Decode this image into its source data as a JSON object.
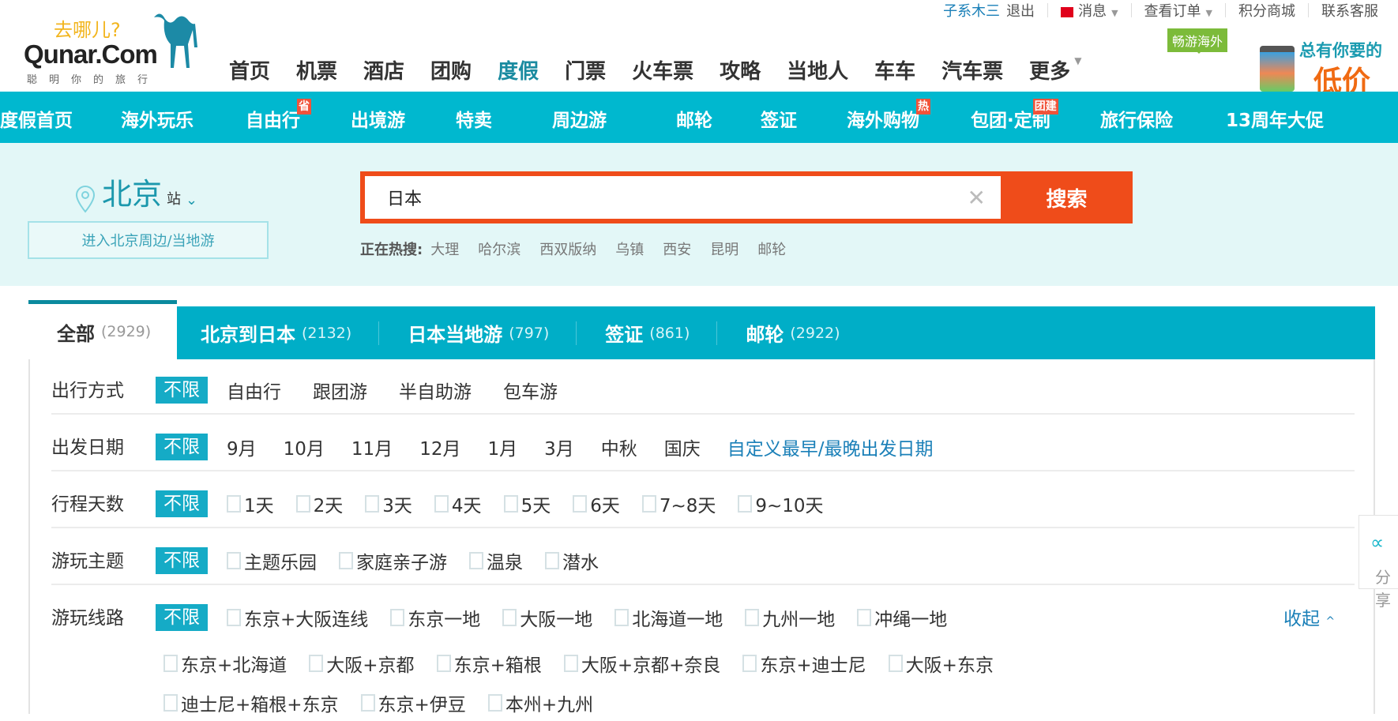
{
  "logo": {
    "slogan": "去哪儿?",
    "brand": "Qunar.Com",
    "sub": "聪明你的旅行"
  },
  "toplinks": {
    "user": "子系木三",
    "logout": "退出",
    "messages": "消息",
    "orders": "查看订单",
    "points": "积分商城",
    "service": "联系客服"
  },
  "mainnav": [
    "首页",
    "机票",
    "酒店",
    "团购",
    "度假",
    "门票",
    "火车票",
    "攻略",
    "当地人",
    "车车",
    "汽车票",
    "更多"
  ],
  "mainnav_active": "度假",
  "badge": "畅游海外",
  "ad": {
    "line1": "总有你要的",
    "line2": "低价"
  },
  "subnav": [
    {
      "label": "度假首页"
    },
    {
      "label": "海外玩乐"
    },
    {
      "label": "自由行",
      "tag": "省"
    },
    {
      "label": "出境游"
    },
    {
      "label": "特卖"
    },
    {
      "label": "周边游"
    },
    {
      "label": "邮轮"
    },
    {
      "label": "签证"
    },
    {
      "label": "海外购物",
      "tag": "热"
    },
    {
      "label": "包团·定制",
      "tag": "团建"
    },
    {
      "label": "旅行保险"
    },
    {
      "label": "13周年大促"
    }
  ],
  "city": {
    "name": "北京",
    "suffix": "站",
    "enter": "进入北京周边/当地游"
  },
  "search": {
    "value": "日本",
    "button": "搜索",
    "hot_label": "正在热搜:",
    "hot": [
      "大理",
      "哈尔滨",
      "西双版纳",
      "乌镇",
      "西安",
      "昆明",
      "邮轮"
    ]
  },
  "tabs": [
    {
      "label": "全部",
      "count": "(2929)"
    },
    {
      "label": "北京到日本",
      "count": "(2132)"
    },
    {
      "label": "日本当地游",
      "count": "(797)"
    },
    {
      "label": "签证",
      "count": "(861)"
    },
    {
      "label": "邮轮",
      "count": "(2922)"
    }
  ],
  "filters": {
    "any": "不限",
    "mode": {
      "label": "出行方式",
      "options": [
        "自由行",
        "跟团游",
        "半自助游",
        "包车游"
      ]
    },
    "date": {
      "label": "出发日期",
      "options": [
        "9月",
        "10月",
        "11月",
        "12月",
        "1月",
        "3月",
        "中秋",
        "国庆"
      ],
      "custom": "自定义最早/最晚出发日期"
    },
    "days": {
      "label": "行程天数",
      "options": [
        "1天",
        "2天",
        "3天",
        "4天",
        "5天",
        "6天",
        "7~8天",
        "9~10天"
      ]
    },
    "theme": {
      "label": "游玩主题",
      "options": [
        "主题乐园",
        "家庭亲子游",
        "温泉",
        "潜水"
      ]
    },
    "route": {
      "label": "游玩线路",
      "line1": [
        "东京+大阪连线",
        "东京一地",
        "大阪一地",
        "北海道一地",
        "九州一地",
        "冲绳一地"
      ],
      "line2": [
        "东京+北海道",
        "大阪+京都",
        "东京+箱根",
        "大阪+京都+奈良",
        "东京+迪士尼",
        "大阪+东京"
      ],
      "line3": [
        "迪士尼+箱根+东京",
        "东京+伊豆",
        "本州+九州"
      ],
      "collapse": "收起"
    }
  },
  "share": "分享"
}
